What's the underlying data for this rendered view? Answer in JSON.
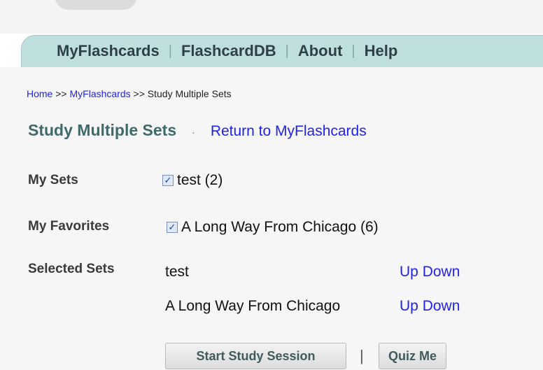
{
  "nav": {
    "items": [
      "MyFlashcards",
      "FlashcardDB",
      "About",
      "Help"
    ],
    "separator": "|"
  },
  "breadcrumb": {
    "home": "Home",
    "sep1": " >> ",
    "myflashcards": "MyFlashcards",
    "sep2": " >> ",
    "current": "Study Multiple Sets"
  },
  "page": {
    "title": "Study Multiple Sets",
    "title_sep": "·",
    "return_link": "Return to MyFlashcards"
  },
  "my_sets": {
    "label": "My Sets",
    "items": [
      {
        "name": "test (2)",
        "checked": true
      }
    ]
  },
  "my_favorites": {
    "label": "My Favorites",
    "items": [
      {
        "name": "A Long Way From Chicago (6)",
        "checked": true
      }
    ]
  },
  "selected_sets": {
    "label": "Selected Sets",
    "items": [
      {
        "name": "test",
        "up": "Up",
        "down": "Down"
      },
      {
        "name": "A Long Way From Chicago",
        "up": "Up",
        "down": "Down"
      }
    ]
  },
  "actions": {
    "start_label": "Start Study Session",
    "separator": "|",
    "quiz_label": "Quiz Me"
  },
  "colors": {
    "nav_bg": "#bfdede",
    "link": "#2222ee",
    "title": "#3f6a6a"
  }
}
